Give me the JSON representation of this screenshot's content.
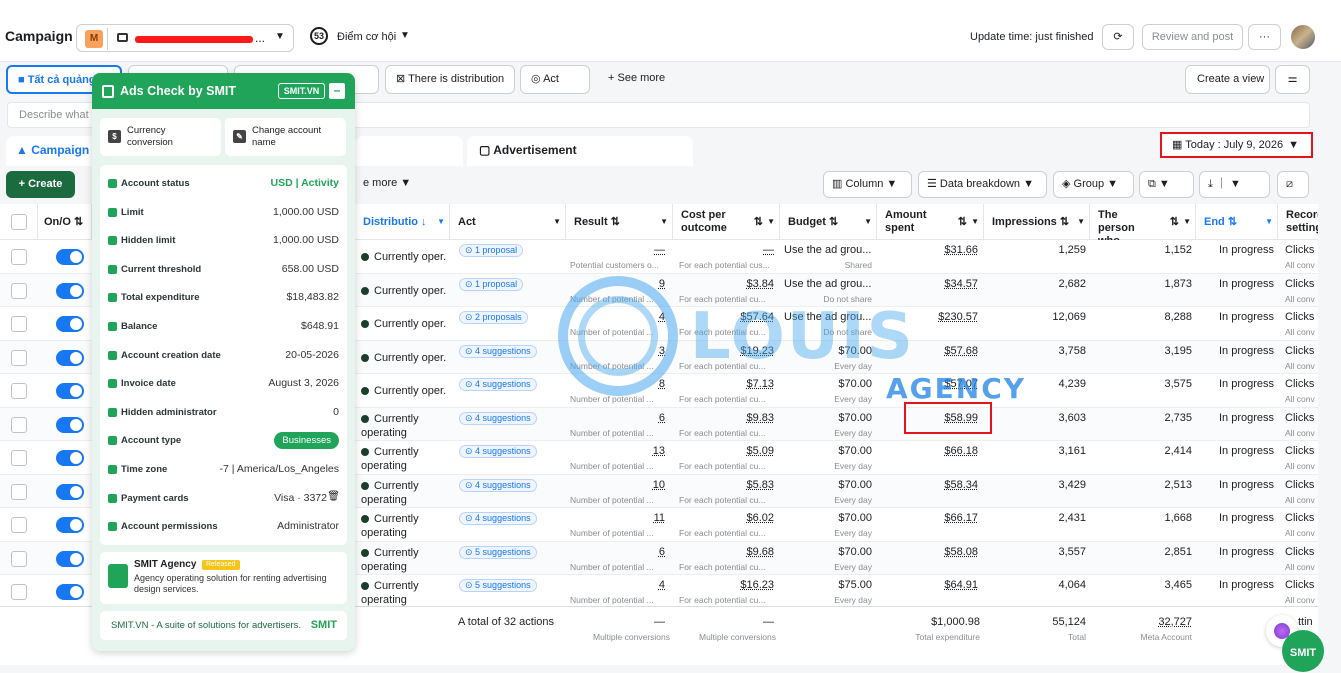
{
  "topbar": {
    "title": "Campaign",
    "account_badge": "M",
    "score": "53",
    "score_label": "Điểm cơ hội",
    "update_time": "Update time: just finished",
    "review_label": "Review and post",
    "more_label": "···"
  },
  "filters": {
    "tab_all": "Tất cả quảng",
    "distribution": "There is distribution",
    "act": "Act",
    "see_more": "See more",
    "create_view": "Create a view",
    "search_placeholder": "Describe what y"
  },
  "levels": {
    "campaign": "Campaign",
    "advertisement": "Advertisement",
    "date": "Today : July 9, 2026"
  },
  "toolbar": {
    "create": "Create",
    "see_more": "e more",
    "column": "Column",
    "breakdown": "Data breakdown",
    "group": "Group"
  },
  "table": {
    "headers": {
      "onoff": "On/O",
      "distribution": "Distributio",
      "act": "Act",
      "result": "Result",
      "cost_per": "Cost per outcome",
      "budget": "Budget",
      "amount": "Amount spent",
      "impressions": "Impressions",
      "person": "The person who...",
      "end": "End",
      "record": "Record setting"
    },
    "rows": [
      {
        "status": "Currently oper.",
        "act": "1 proposal",
        "result": "—",
        "result_sub": "Potential customers o...",
        "cost": "—",
        "cost_sub": "For each potential cus...",
        "budget": "Use the ad grou...",
        "budget_sub": "Shared",
        "amount": "$31.66",
        "impr": "1,259",
        "person": "1,152",
        "end": "In progress",
        "rec": "Clicks",
        "rec_sub": "All conv"
      },
      {
        "status": "Currently oper.",
        "act": "1 proposal",
        "result": "9",
        "result_sub": "Number of potential ...",
        "cost": "$3.84",
        "cost_sub": "For each potential cu...",
        "budget": "Use the ad grou...",
        "budget_sub": "Do not share",
        "amount": "$34.57",
        "impr": "2,682",
        "person": "1,873",
        "end": "In progress",
        "rec": "Clicks",
        "rec_sub": "All conv"
      },
      {
        "status": "Currently oper.",
        "act": "2 proposals",
        "result": "4",
        "result_sub": "Number of potential ...",
        "cost": "$57.64",
        "cost_sub": "For each potential cu...",
        "budget": "Use the ad grou...",
        "budget_sub": "Do not share",
        "amount": "$230.57",
        "impr": "12,069",
        "person": "8,288",
        "end": "In progress",
        "rec": "Clicks",
        "rec_sub": "All conv"
      },
      {
        "status": "Currently oper.",
        "act": "4 suggestions",
        "result": "3",
        "result_sub": "Number of potential ...",
        "cost": "$19.23",
        "cost_sub": "For each potential cu...",
        "budget": "$70.00",
        "budget_sub": "Every day",
        "amount": "$57.68",
        "impr": "3,758",
        "person": "3,195",
        "end": "In progress",
        "rec": "Clicks",
        "rec_sub": "All conv"
      },
      {
        "status": "Currently oper.",
        "act": "4 suggestions",
        "result": "8",
        "result_sub": "Number of potential ...",
        "cost": "$7.13",
        "cost_sub": "For each potential cu...",
        "budget": "$70.00",
        "budget_sub": "Every day",
        "amount": "$57.07",
        "impr": "4,239",
        "person": "3,575",
        "end": "In progress",
        "rec": "Clicks",
        "rec_sub": "All conv"
      },
      {
        "status": "Currently operating",
        "act": "4 suggestions",
        "result": "6",
        "result_sub": "Number of potential ...",
        "cost": "$9.83",
        "cost_sub": "For each potential cu...",
        "budget": "$70.00",
        "budget_sub": "Every day",
        "amount": "$58.99",
        "impr": "3,603",
        "person": "2,735",
        "end": "In progress",
        "rec": "Clicks",
        "rec_sub": "All conv"
      },
      {
        "status": "Currently operating",
        "act": "4 suggestions",
        "result": "13",
        "result_sub": "Number of potential ...",
        "cost": "$5.09",
        "cost_sub": "For each potential cu...",
        "budget": "$70.00",
        "budget_sub": "Every day",
        "amount": "$66.18",
        "impr": "3,161",
        "person": "2,414",
        "end": "In progress",
        "rec": "Clicks",
        "rec_sub": "All conv"
      },
      {
        "status": "Currently operating",
        "act": "4 suggestions",
        "result": "10",
        "result_sub": "Number of potential ...",
        "cost": "$5.83",
        "cost_sub": "For each potential cu...",
        "budget": "$70.00",
        "budget_sub": "Every day",
        "amount": "$58.34",
        "impr": "3,429",
        "person": "2,513",
        "end": "In progress",
        "rec": "Clicks",
        "rec_sub": "All conv"
      },
      {
        "status": "Currently operating",
        "act": "4 suggestions",
        "result": "11",
        "result_sub": "Number of potential ...",
        "cost": "$6.02",
        "cost_sub": "For each potential cu...",
        "budget": "$70.00",
        "budget_sub": "Every day",
        "amount": "$66.17",
        "impr": "2,431",
        "person": "1,668",
        "end": "In progress",
        "rec": "Clicks",
        "rec_sub": "All conv"
      },
      {
        "status": "Currently operating",
        "act": "5 suggestions",
        "result": "6",
        "result_sub": "Number of potential ...",
        "cost": "$9.68",
        "cost_sub": "For each potential cu...",
        "budget": "$70.00",
        "budget_sub": "Every day",
        "amount": "$58.08",
        "impr": "3,557",
        "person": "2,851",
        "end": "In progress",
        "rec": "Clicks",
        "rec_sub": "All conv"
      },
      {
        "status": "Currently operating",
        "act": "5 suggestions",
        "result": "4",
        "result_sub": "Number of potential ...",
        "cost": "$16.23",
        "cost_sub": "For each potential cu...",
        "budget": "$75.00",
        "budget_sub": "Every day",
        "amount": "$64.91",
        "impr": "4,064",
        "person": "3,465",
        "end": "In progress",
        "rec": "Clicks",
        "rec_sub": "All conv"
      }
    ],
    "footer": {
      "total_actions": "A total of 32 actions",
      "result": "—",
      "result_sub": "Multiple conversions",
      "cost": "—",
      "cost_sub": "Multiple conversions",
      "amount": "$1,000.98",
      "amount_sub": "Total expenditure",
      "impr": "55,124",
      "impr_sub": "Total",
      "person": "32,727",
      "person_sub": "Meta Account",
      "rec": "ttin"
    }
  },
  "panel": {
    "title": "Ads Check by SMIT",
    "badge": "SMIT.VN",
    "minimize": "–",
    "currency": "Currency conversion",
    "change_name": "Change account name",
    "rows": [
      {
        "k": "Account status",
        "v": "USD | Activity"
      },
      {
        "k": "Limit",
        "v": "1,000.00 USD"
      },
      {
        "k": "Hidden limit",
        "v": "1,000.00 USD"
      },
      {
        "k": "Current threshold",
        "v": "658.00 USD"
      },
      {
        "k": "Total expenditure",
        "v": "$18,483.82"
      },
      {
        "k": "Balance",
        "v": "$648.91"
      },
      {
        "k": "Account creation date",
        "v": "20-05-2026"
      },
      {
        "k": "Invoice date",
        "v": "August 3, 2026"
      },
      {
        "k": "Hidden administrator",
        "v": "0"
      },
      {
        "k": "Account type",
        "v": "Businesses"
      },
      {
        "k": "Time zone",
        "v": "-7 | America/Los_Angeles"
      },
      {
        "k": "Payment cards",
        "v": "Visa · 3372"
      },
      {
        "k": "Account permissions",
        "v": "Administrator"
      }
    ],
    "agency_name": "SMIT Agency",
    "agency_tag": "Released",
    "agency_desc": "Agency operating solution for renting advertising design services.",
    "footer": "SMIT.VN - A suite of solutions for advertisers.",
    "footer_logo": "SMIT"
  },
  "watermark": {
    "main": "LOUIS",
    "sub": "AGENCY"
  },
  "fab": "SMIT"
}
